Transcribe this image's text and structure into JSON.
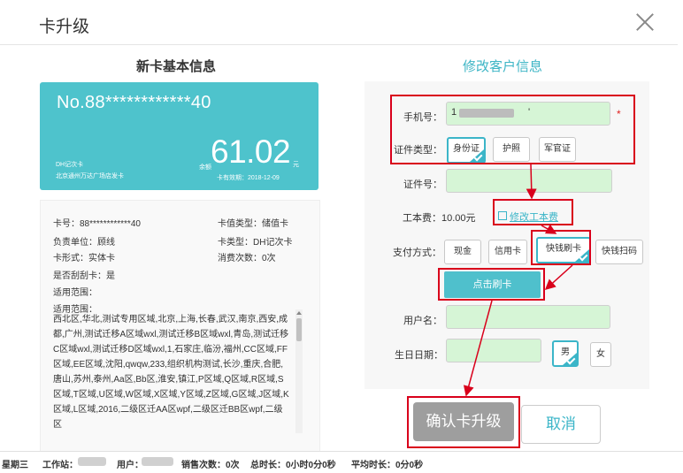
{
  "dialog": {
    "title": "卡升级"
  },
  "left": {
    "section_title": "新卡基本信息",
    "card": {
      "number": "No.88************40",
      "type_name": "DH记次卡",
      "issuer": "北京通州万达广场店发卡",
      "balance_label": "余额",
      "balance": "61.02",
      "balance_unit": "元",
      "expiry": "卡有效期：2018-12-09"
    },
    "info": {
      "card_no": "卡号：88************40",
      "value_type": "卡值类型：储值卡",
      "unit": "负责单位：顾线",
      "card_type": "卡类型：DH记次卡",
      "form": "卡形式：实体卡",
      "consume_count": "消费次数：0次",
      "scratch": "是否刮刮卡：是",
      "scope_label_1": "适用范围：",
      "scope_label_2": "适用范围：",
      "scope_text": "西北区,华北,测试专用区域,北京,上海,长春,武汉,南京,西安,成都,广州,测试迁移A区域wxl,测试迁移B区域wxl,青岛,测试迁移C区域wxl,测试迁移D区域wxl,1,石家庄,临汾,福州,CC区域,FF区域,EE区域,沈阳,qwqw,233,组织机构测试,长沙,重庆,合肥,唐山,苏州,泰州,Aa区,Bb区,淮安,镇江,P区域,Q区域,R区域,S区域,T区域,U区域,W区域,X区域,Y区域,Z区域,G区域,J区域,K区域,L区域,2016,二级区迁AA区wpf,二级区迁BB区wpf,二级区"
    }
  },
  "right": {
    "section_title": "修改客户信息",
    "phone": {
      "label": "手机号：",
      "prefix": "1",
      "suffix": "'",
      "required_mark": "*"
    },
    "id_type": {
      "label": "证件类型：",
      "options": [
        "身份证",
        "护照",
        "军官证"
      ],
      "selected": "身份证"
    },
    "id_no": {
      "label": "证件号："
    },
    "fee": {
      "label": "工本费：10.00元",
      "edit_link": "修改工本费"
    },
    "pay": {
      "label": "支付方式：",
      "options": [
        "现金",
        "信用卡",
        "快钱刷卡",
        "快钱扫码"
      ],
      "selected": "快钱刷卡"
    },
    "swipe_button": "点击刷卡",
    "username": {
      "label": "用户名："
    },
    "birthday": {
      "label": "生日日期："
    },
    "gender": {
      "options": [
        "男",
        "女"
      ],
      "selected": "男"
    },
    "confirm_button": "确认卡升级",
    "cancel_button": "取消"
  },
  "status_bar": {
    "weekday": "星期三",
    "workstation": "工作站：",
    "user": "用户：",
    "sales": "销售次数：0次",
    "total_time": "总时长：0小时0分0秒",
    "avg_time": "平均时长：0分0秒"
  },
  "colors": {
    "accent": "#3bb5c8",
    "annotation": "#d9001b",
    "field_bg": "#d6f5d6"
  }
}
